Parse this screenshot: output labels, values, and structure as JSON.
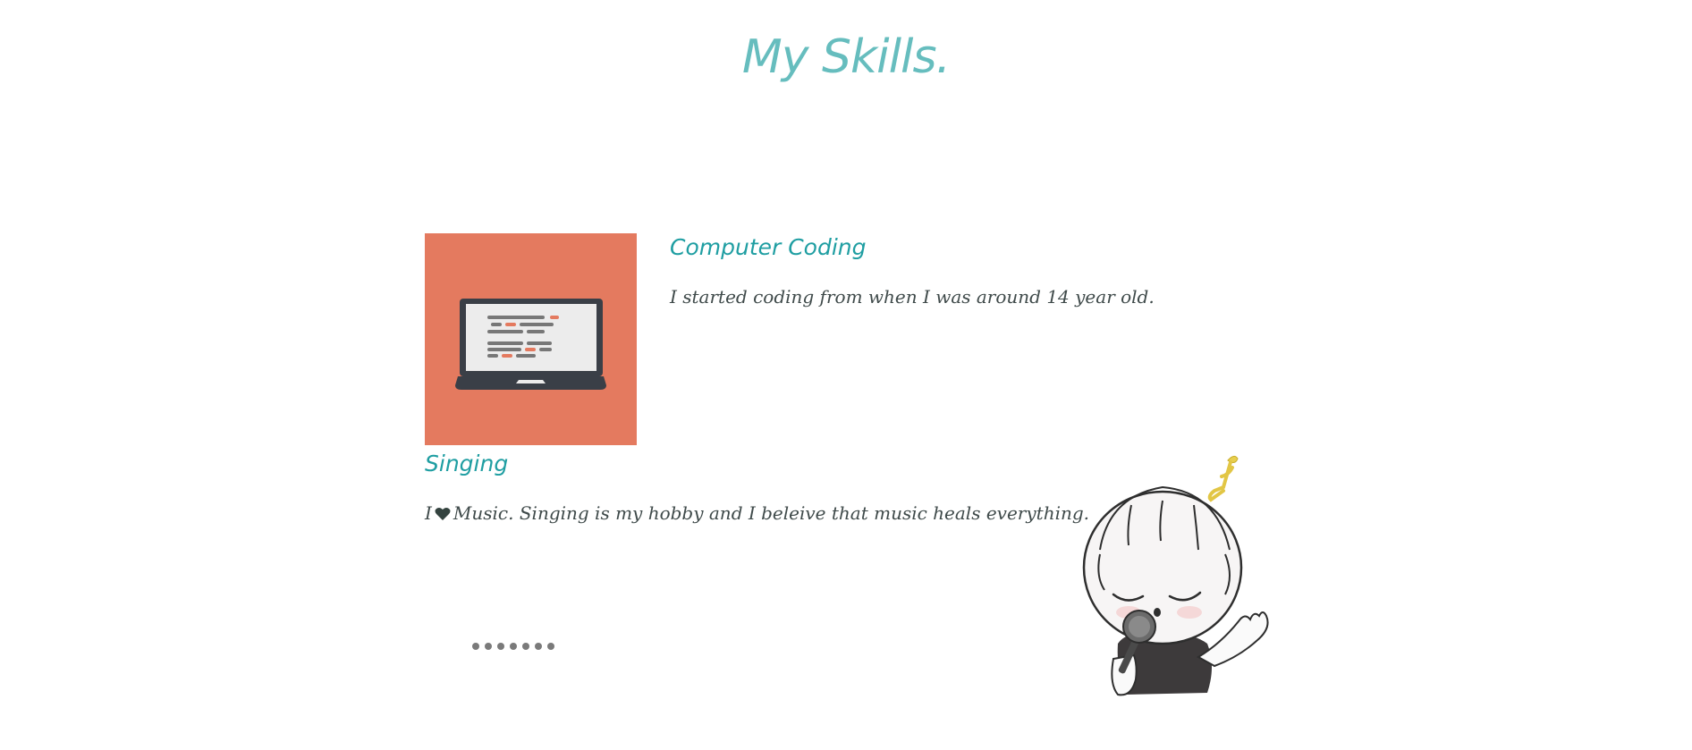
{
  "header": {
    "title": "My Skills."
  },
  "skills": [
    {
      "heading": "Computer Coding",
      "text": "I started coding from when I was around 14 year old.",
      "image_icon": "laptop-icon",
      "image_bg": "#e47a5f"
    },
    {
      "heading": "Singing",
      "text_before": "I",
      "text_after": "Music. Singing is my hobby and I beleive that music heals everything.",
      "inline_icon": "heart-icon",
      "illustration": "singing-character-illustration"
    }
  ],
  "pagination": {
    "dot_count": 7
  },
  "colors": {
    "accent": "#66bdbe",
    "heading": "#1f9ea2",
    "text": "#3f4a4a",
    "dot": "#7a7a7a"
  }
}
